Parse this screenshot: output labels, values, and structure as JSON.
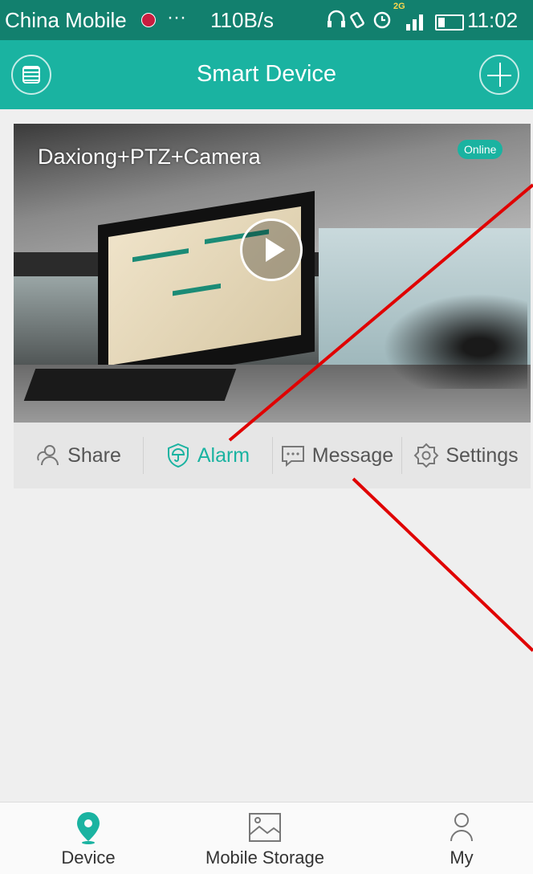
{
  "status_bar": {
    "carrier": "China Mobile",
    "dots": "···",
    "speed": "110B/s",
    "network": "2G",
    "time": "11:02"
  },
  "header": {
    "title": "Smart Device",
    "menu_icon": "menu-icon",
    "add_icon": "plus-icon"
  },
  "device_card": {
    "name": "Daxiong+PTZ+Camera",
    "status": "Online",
    "actions": [
      {
        "label": "Share",
        "icon": "share-icon",
        "active": false
      },
      {
        "label": "Alarm",
        "icon": "alarm-shield-icon",
        "active": true
      },
      {
        "label": "Message",
        "icon": "message-icon",
        "active": false
      },
      {
        "label": "Settings",
        "icon": "settings-icon",
        "active": false
      }
    ]
  },
  "tab_bar": {
    "items": [
      {
        "label": "Device",
        "icon": "location-pin-icon",
        "active": true
      },
      {
        "label": "Mobile Storage",
        "icon": "image-icon",
        "active": false
      },
      {
        "label": "My",
        "icon": "person-icon",
        "active": false
      }
    ]
  },
  "colors": {
    "accent": "#1ab3a1",
    "status_bar": "#12806e",
    "annotation": "#e00000"
  }
}
